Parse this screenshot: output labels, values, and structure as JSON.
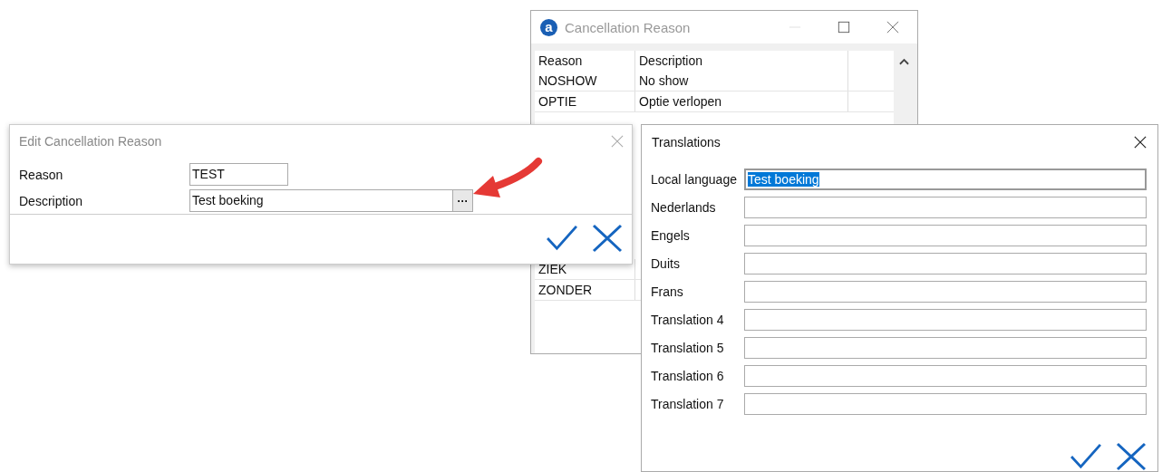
{
  "reason_window": {
    "logo_text": "a",
    "title": "Cancellation Reason",
    "columns": [
      "Reason",
      "Description"
    ],
    "rows_top": [
      {
        "reason": "NOSHOW",
        "description": "No show"
      },
      {
        "reason": "OPTIE",
        "description": "Optie verlopen"
      }
    ],
    "rows_bottom": [
      {
        "reason": "ZIEK"
      },
      {
        "reason": "ZONDER"
      }
    ]
  },
  "edit_dialog": {
    "title": "Edit Cancellation Reason",
    "fields": [
      {
        "label": "Reason",
        "value": "TEST",
        "kind": "short"
      },
      {
        "label": "Description",
        "value": "Test boeking",
        "kind": "browse",
        "button": "···"
      }
    ]
  },
  "translations_dialog": {
    "title": "Translations",
    "fields": [
      {
        "label": "Local language",
        "value": "Test boeking",
        "selected": true
      },
      {
        "label": "Nederlands",
        "selected": false
      },
      {
        "label": "Engels",
        "selected": false
      },
      {
        "label": "Duits",
        "selected": false
      },
      {
        "label": "Frans",
        "selected": false
      },
      {
        "label": "Translation 4",
        "selected": false
      },
      {
        "label": "Translation 5",
        "selected": false
      },
      {
        "label": "Translation 6",
        "selected": false
      },
      {
        "label": "Translation 7",
        "selected": false
      }
    ]
  }
}
